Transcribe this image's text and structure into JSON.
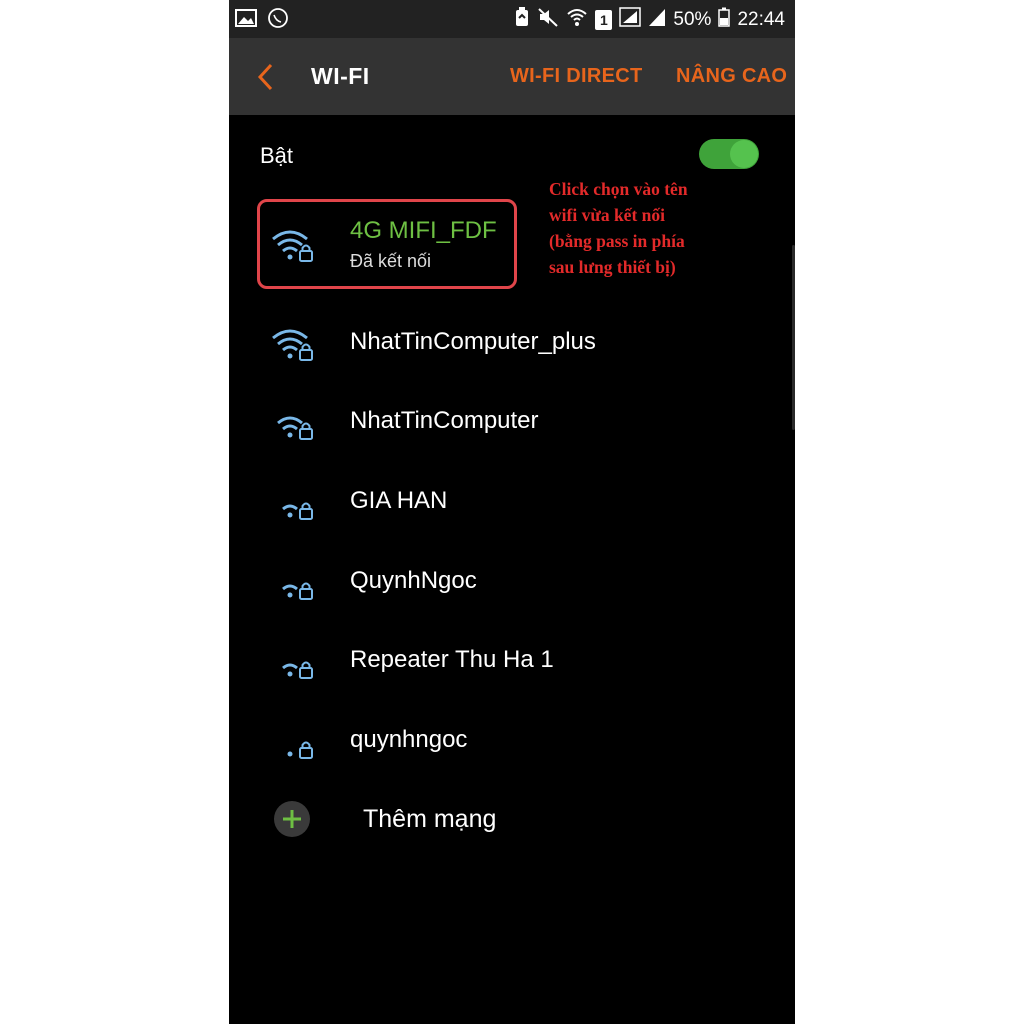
{
  "status_bar": {
    "battery_percent": "50%",
    "time": "22:44",
    "sim_slot": "1",
    "left_icons": [
      "gallery-icon",
      "viber-icon"
    ],
    "right_icons": [
      "battery-saver-icon",
      "mute-icon",
      "wifi-status-icon",
      "sim-icon",
      "signal-icon",
      "signal-icon",
      "battery-icon"
    ]
  },
  "app_bar": {
    "title": "WI-FI",
    "wifi_direct_label": "WI-FI DIRECT",
    "advanced_label": "NÂNG CAO"
  },
  "toggle": {
    "label": "Bật",
    "on": true
  },
  "connected_network": {
    "name": "4G MIFI_FDF",
    "status": "Đã kết nối",
    "signal_bars": 3,
    "secured": true
  },
  "networks": [
    {
      "name": "NhatTinComputer_plus",
      "signal_bars": 3,
      "secured": true
    },
    {
      "name": "NhatTinComputer",
      "signal_bars": 2,
      "secured": true
    },
    {
      "name": "GIA HAN",
      "signal_bars": 1,
      "secured": true
    },
    {
      "name": "QuynhNgoc",
      "signal_bars": 1,
      "secured": true
    },
    {
      "name": "Repeater Thu Ha 1",
      "signal_bars": 1,
      "secured": true
    },
    {
      "name": "quynhngoc",
      "signal_bars": 0,
      "secured": true
    }
  ],
  "add_network": {
    "label": "Thêm mạng"
  },
  "annotation": {
    "lines": [
      "Click chọn vào tên",
      "wifi vừa kết nối",
      "(bằng pass in phía",
      "sau lưng thiết bị)"
    ]
  },
  "colors": {
    "accent": "#e8651c",
    "connected_text": "#6ec043",
    "toggle_on": "#3fa33a",
    "wifi_icon": "#7ab8e8",
    "annotation": "#e32a2a"
  }
}
